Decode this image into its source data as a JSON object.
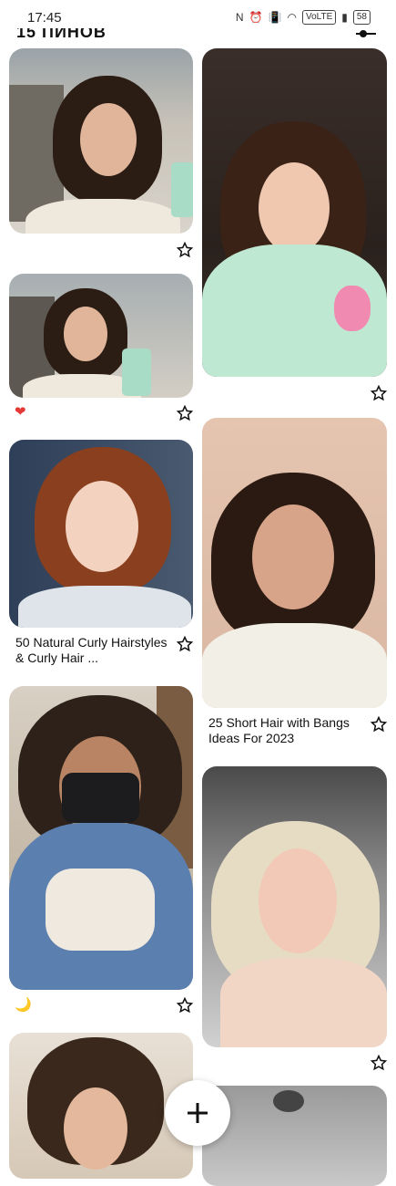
{
  "status_bar": {
    "time": "17:45",
    "icons": [
      "nfc-icon",
      "alarm-icon",
      "vibrate-icon",
      "wifi-icon",
      "volte-icon",
      "signal-icon"
    ],
    "volte": "VoLTE",
    "battery": "58"
  },
  "header": {
    "title": "15 ПИНОВ"
  },
  "pins": [
    {
      "id": "pin-1",
      "caption": "",
      "reaction": ""
    },
    {
      "id": "pin-2",
      "caption": "",
      "reaction": ""
    },
    {
      "id": "pin-3",
      "caption": "",
      "reaction": "❤"
    },
    {
      "id": "pin-4",
      "caption": "50 Natural Curly Hairstyles & Curly Hair ...",
      "reaction": ""
    },
    {
      "id": "pin-5",
      "caption": "25 Short Hair with Bangs Ideas For 2023",
      "reaction": ""
    },
    {
      "id": "pin-6",
      "caption": "",
      "reaction": "🌙"
    },
    {
      "id": "pin-7",
      "caption": "",
      "reaction": ""
    }
  ],
  "colors": {
    "reaction_heart": "#e53935",
    "fab_bg": "#ffffff"
  }
}
